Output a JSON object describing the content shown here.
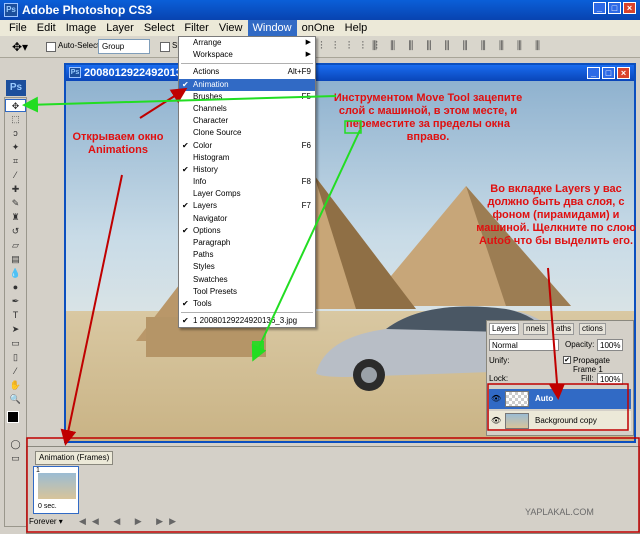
{
  "app": {
    "title": "Adobe Photoshop CS3",
    "logo": "Ps"
  },
  "menubar": [
    "File",
    "Edit",
    "Image",
    "Layer",
    "Select",
    "Filter",
    "View",
    "Window",
    "onOne",
    "Help"
  ],
  "options": {
    "auto_select_label": "Auto-Select:",
    "auto_select_value": "Group",
    "show_label": "Sh"
  },
  "document": {
    "title": "20080129224920136"
  },
  "window_menu": {
    "top": [
      {
        "label": "Arrange",
        "sub": true
      },
      {
        "label": "Workspace",
        "sub": true
      }
    ],
    "items": [
      {
        "label": "Actions",
        "shortcut": "Alt+F9",
        "checked": false
      },
      {
        "label": "Animation",
        "shortcut": "",
        "checked": true,
        "highlight": true
      },
      {
        "label": "Brushes",
        "shortcut": "F5",
        "checked": false
      },
      {
        "label": "Channels",
        "shortcut": "",
        "checked": false
      },
      {
        "label": "Character",
        "shortcut": "",
        "checked": false
      },
      {
        "label": "Clone Source",
        "shortcut": "",
        "checked": false
      },
      {
        "label": "Color",
        "shortcut": "F6",
        "checked": true
      },
      {
        "label": "Histogram",
        "shortcut": "",
        "checked": false
      },
      {
        "label": "History",
        "shortcut": "",
        "checked": true
      },
      {
        "label": "Info",
        "shortcut": "F8",
        "checked": false
      },
      {
        "label": "Layer Comps",
        "shortcut": "",
        "checked": false
      },
      {
        "label": "Layers",
        "shortcut": "F7",
        "checked": true
      },
      {
        "label": "Navigator",
        "shortcut": "",
        "checked": false
      },
      {
        "label": "Options",
        "shortcut": "",
        "checked": true
      },
      {
        "label": "Paragraph",
        "shortcut": "",
        "checked": false
      },
      {
        "label": "Paths",
        "shortcut": "",
        "checked": false
      },
      {
        "label": "Styles",
        "shortcut": "",
        "checked": false
      },
      {
        "label": "Swatches",
        "shortcut": "",
        "checked": false
      },
      {
        "label": "Tool Presets",
        "shortcut": "",
        "checked": false
      },
      {
        "label": "Tools",
        "shortcut": "",
        "checked": true
      }
    ],
    "doc_item": {
      "label": "1 20080129224920136_3.jpg",
      "checked": true
    }
  },
  "notes": {
    "animations": "Открываем окно Animations",
    "move_tool": "Инструментом Move Tool зацепите слой с машиной, в этом месте, и переместите за пределы окна вправо.",
    "layers": "Во вкладке Layers у вас должно быть два слоя, с фоном (пирамидами) и машиной. Щелкните по слою Autoб что бы выделить его."
  },
  "layers_panel": {
    "tabs": [
      "Layers",
      "nnels",
      "aths",
      "ctions"
    ],
    "blend": "Normal",
    "opacity_label": "Opacity:",
    "opacity": "100%",
    "unify_label": "Unify:",
    "propagate_label": "Propagate Frame 1",
    "lock_label": "Lock:",
    "fill_label": "Fill:",
    "fill": "100%",
    "layers": [
      {
        "name": "Auto",
        "selected": true
      },
      {
        "name": "Background copy",
        "selected": false
      }
    ]
  },
  "animation_panel": {
    "tab": "Animation (Frames)",
    "frame_no": "1",
    "frame_time": "0 sec.",
    "loop": "Forever"
  },
  "watermark": "YAPLAKAL.COM",
  "colors": {
    "note": "#e01010",
    "arrow_red": "#c00000",
    "arrow_green": "#22dd22",
    "highlight": "#316ac5"
  }
}
